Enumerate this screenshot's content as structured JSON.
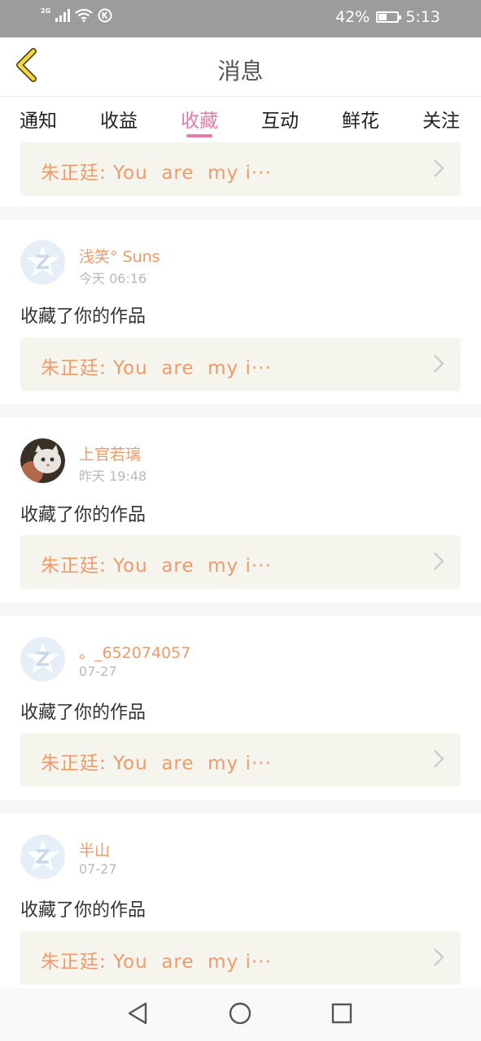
{
  "status_bar": {
    "network": "2G",
    "battery_percent": "42%",
    "battery_level": 0.42,
    "time": "5:13"
  },
  "header": {
    "back_icon": "chevron-left-icon",
    "title": "消息"
  },
  "tabs": [
    {
      "label": "通知",
      "active": false
    },
    {
      "label": "收益",
      "active": false
    },
    {
      "label": "收藏",
      "active": true
    },
    {
      "label": "互动",
      "active": false
    },
    {
      "label": "鲜花",
      "active": false
    },
    {
      "label": "关注",
      "active": false
    }
  ],
  "colors": {
    "accent": "#e57ba8",
    "name": "#ee9a6a",
    "card_bg": "#f5f5ee"
  },
  "feed": {
    "top_partial": {
      "ref_text": "朱正廷: You  are  my i···"
    },
    "items": [
      {
        "username": "浅笑° Suns",
        "time": "今天 06:16",
        "action": "收藏了你的作品",
        "ref_text": "朱正廷: You  are  my i···",
        "avatar": "default-avatar"
      },
      {
        "username": "上官若璃",
        "time": "昨天 19:48",
        "action": "收藏了你的作品",
        "ref_text": "朱正廷: You  are  my i···",
        "avatar": "photo-avatar"
      },
      {
        "username": "。_652074057",
        "time": "07-27",
        "action": "收藏了你的作品",
        "ref_text": "朱正廷: You  are  my i···",
        "avatar": "default-avatar"
      },
      {
        "username": "半山",
        "time": "07-27",
        "action": "收藏了你的作品",
        "ref_text": "朱正廷: You  are  my i···",
        "avatar": "default-avatar"
      }
    ]
  },
  "navbar": {
    "back": "triangle-back-icon",
    "home": "circle-home-icon",
    "recents": "square-recents-icon"
  }
}
